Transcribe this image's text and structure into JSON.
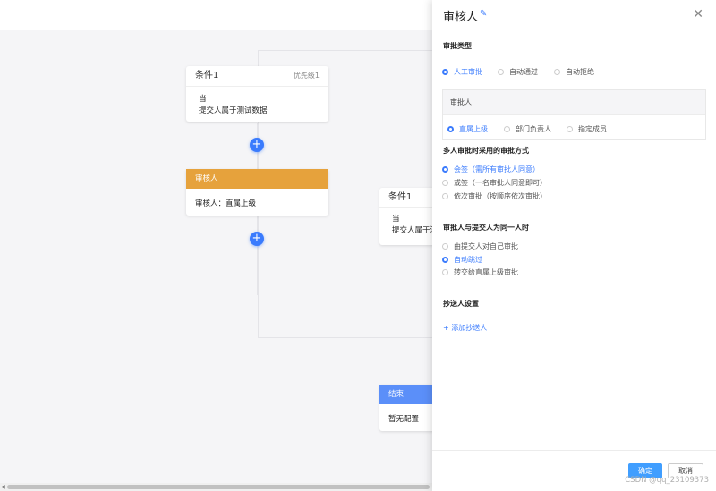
{
  "canvas": {
    "condition1": {
      "title": "条件1",
      "priority": "优先级1",
      "line1": "当",
      "line2": "提交人属于测试数据"
    },
    "approver_node": {
      "title": "审核人",
      "content": "审核人：直属上级"
    },
    "condition2": {
      "title": "条件1",
      "line1": "当",
      "line2": "提交人属于测"
    },
    "end_node": {
      "title": "结束",
      "content": "暂无配置"
    },
    "add_symbol": "+"
  },
  "drawer": {
    "title": "审核人",
    "edit_icon": "✎",
    "close_icon": "✕",
    "approval_type": {
      "label": "审批类型",
      "options": [
        "人工审批",
        "自动通过",
        "自动拒绝"
      ],
      "selected": "人工审批"
    },
    "approver": {
      "label": "审批人",
      "options": [
        "直属上级",
        "部门负责人",
        "指定成员"
      ],
      "selected": "直属上级"
    },
    "multi_method": {
      "label": "多人审批时采用的审批方式",
      "options": [
        "会签（需所有审批人同意）",
        "或签（一名审批人同意即可）",
        "依次审批（按顺序依次审批）"
      ],
      "selected": "会签（需所有审批人同意）"
    },
    "same_person": {
      "label": "审批人与提交人为同一人时",
      "options": [
        "由提交人对自己审批",
        "自动跳过",
        "转交给直属上级审批"
      ],
      "selected": "自动跳过"
    },
    "cc": {
      "label": "抄送人设置",
      "add_label": "+ 添加抄送人"
    },
    "buttons": {
      "ok": "确定",
      "cancel": "取消"
    }
  },
  "watermark": "CSDN @qq_23109373",
  "colors": {
    "primary": "#409eff",
    "approver": "#e6a23c",
    "end": "#5b8ff9"
  }
}
